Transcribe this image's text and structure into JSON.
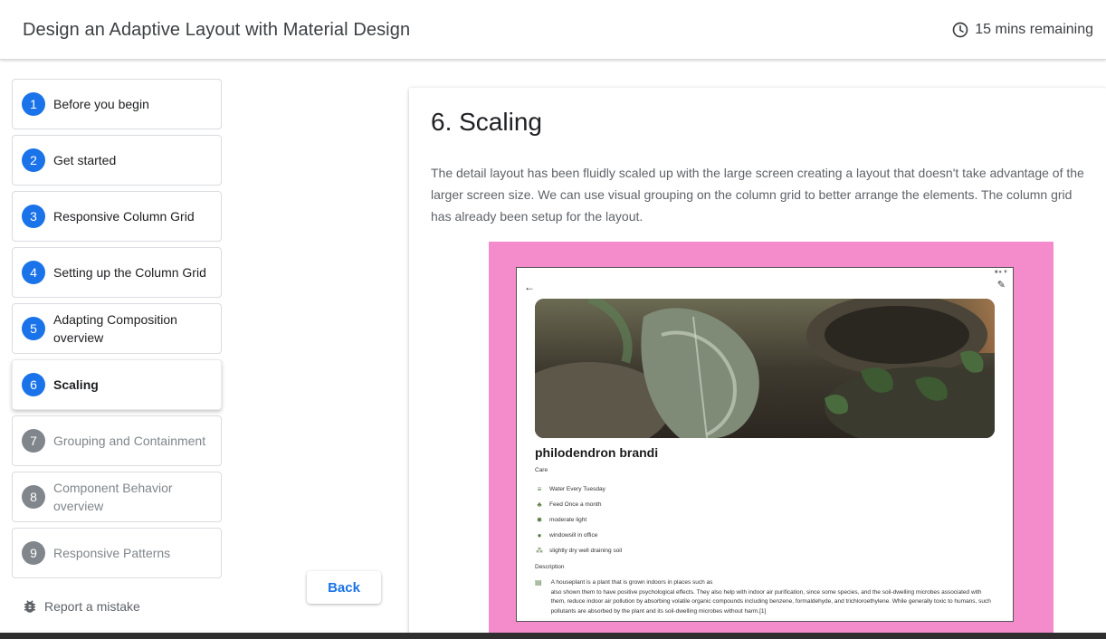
{
  "header": {
    "title": "Design an Adaptive Layout with Material Design",
    "time_remaining": "15 mins remaining",
    "timer_icon": "clock-icon"
  },
  "steps": [
    {
      "number": "1",
      "label": "Before you begin",
      "state": "done"
    },
    {
      "number": "2",
      "label": "Get started",
      "state": "done"
    },
    {
      "number": "3",
      "label": "Responsive Column Grid",
      "state": "done"
    },
    {
      "number": "4",
      "label": "Setting up the Column Grid",
      "state": "done"
    },
    {
      "number": "5",
      "label": "Adapting Composition overview",
      "state": "done"
    },
    {
      "number": "6",
      "label": "Scaling",
      "state": "active"
    },
    {
      "number": "7",
      "label": "Grouping and Containment",
      "state": "future"
    },
    {
      "number": "8",
      "label": "Component Behavior overview",
      "state": "future"
    },
    {
      "number": "9",
      "label": "Responsive Patterns",
      "state": "future"
    }
  ],
  "footer": {
    "report_label": "Report a mistake",
    "report_icon": "bug-icon",
    "back_label": "Back"
  },
  "content": {
    "heading": "6. Scaling",
    "body": "The detail layout has been fluidly scaled up with the large screen creating a layout that doesn't take advantage of the larger screen size. We can use visual grouping on the column grid to better arrange the elements. The column grid has already been setup for the layout."
  },
  "mockup": {
    "plant_name": "philodendron brandi",
    "care_label": "Care",
    "care_items": [
      {
        "icon": "water-icon",
        "text": "Water Every Tuesday"
      },
      {
        "icon": "leaf-icon",
        "text": "Feed Once a month"
      },
      {
        "icon": "sun-icon",
        "text": "moderate light"
      },
      {
        "icon": "location-pin-icon",
        "text": "windowsill in office"
      },
      {
        "icon": "soil-icon",
        "text": "slightly dry well draining soil"
      }
    ],
    "description_label": "Description",
    "description_line_1": "A houseplant is a plant that is grown indoors in places such as",
    "description_line_2": "also shown them to have positive psychological effects. They also help with indoor air purification, since some species, and the soil-dwelling microbes associated with them, reduce indoor air pollution by absorbing volatile organic compounds including benzene, formaldehyde, and trichloroethylene. While generally toxic to humans, such pollutants are absorbed by the plant and its soil-dwelling microbes without harm.[1]"
  },
  "colors": {
    "accent": "#1a73e8",
    "inactive_step": "#80868b",
    "mockup_background": "#f48ccc"
  }
}
